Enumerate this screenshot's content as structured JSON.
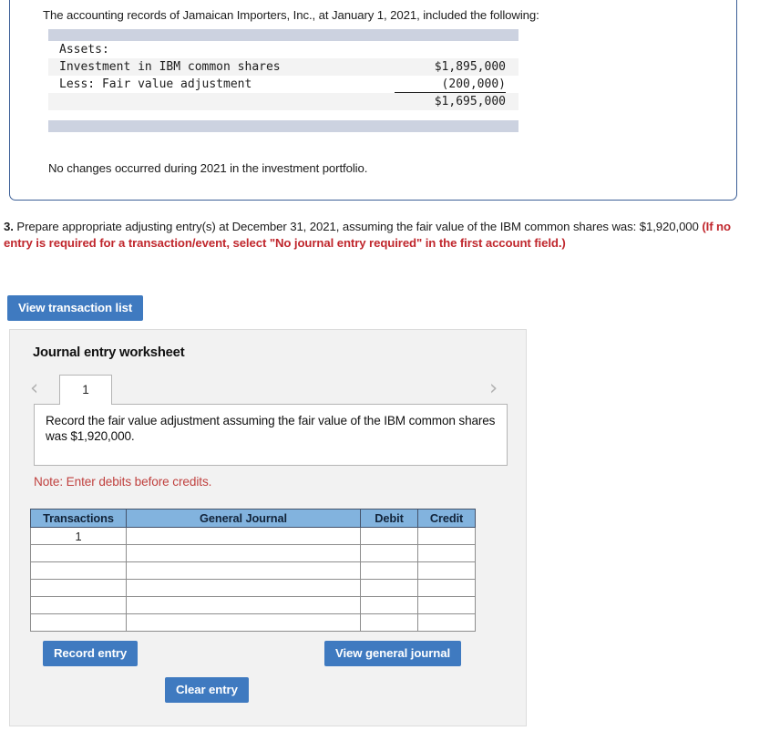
{
  "fact_box": {
    "intro_text": "The accounting records of Jamaican Importers, Inc., at January 1, 2021, included the following:",
    "statement": {
      "heading_label": "Assets:",
      "rows": [
        {
          "label": "Investment in IBM common shares",
          "amount": "$1,895,000"
        },
        {
          "label": "Less: Fair value adjustment",
          "amount": "(200,000)"
        }
      ],
      "total_amount": "$1,695,000"
    },
    "closing_text": "No changes occurred during 2021 in the investment portfolio."
  },
  "requirement": {
    "number": "3.",
    "text": " Prepare appropriate adjusting entry(s) at December 31, 2021, assuming the fair value of the IBM common shares was: $1,920,000 ",
    "hint": "(If no entry is required for a transaction/event, select \"No journal entry required\" in the first account field.)"
  },
  "buttons": {
    "view_transaction_list": "View transaction list",
    "record_entry": "Record entry",
    "view_general_journal": "View general journal",
    "clear_entry": "Clear entry"
  },
  "worksheet": {
    "title": "Journal entry worksheet",
    "prev_arrow": "‹",
    "next_arrow": "›",
    "tabs": [
      {
        "label": "1",
        "selected": true
      }
    ],
    "entry_description": "Record the fair value adjustment assuming the fair value of the IBM common shares was $1,920,000.",
    "note": "Note: Enter debits before credits.",
    "table": {
      "columns": [
        "Transactions",
        "General Journal",
        "Debit",
        "Credit"
      ],
      "rows": [
        {
          "transaction": "1",
          "general_journal": "",
          "debit": "",
          "credit": ""
        },
        {
          "transaction": "",
          "general_journal": "",
          "debit": "",
          "credit": ""
        },
        {
          "transaction": "",
          "general_journal": "",
          "debit": "",
          "credit": ""
        },
        {
          "transaction": "",
          "general_journal": "",
          "debit": "",
          "credit": ""
        },
        {
          "transaction": "",
          "general_journal": "",
          "debit": "",
          "credit": ""
        },
        {
          "transaction": "",
          "general_journal": "",
          "debit": "",
          "credit": ""
        }
      ]
    }
  },
  "colors": {
    "box_border": "#3c5f97",
    "button_blue": "#3f7ac0",
    "table_header_blue": "#82b3de",
    "hint_red": "#c0272d",
    "note_red": "#c0413f",
    "statement_bar": "#ccd2e0",
    "panel_background": "#f2f2f2"
  }
}
